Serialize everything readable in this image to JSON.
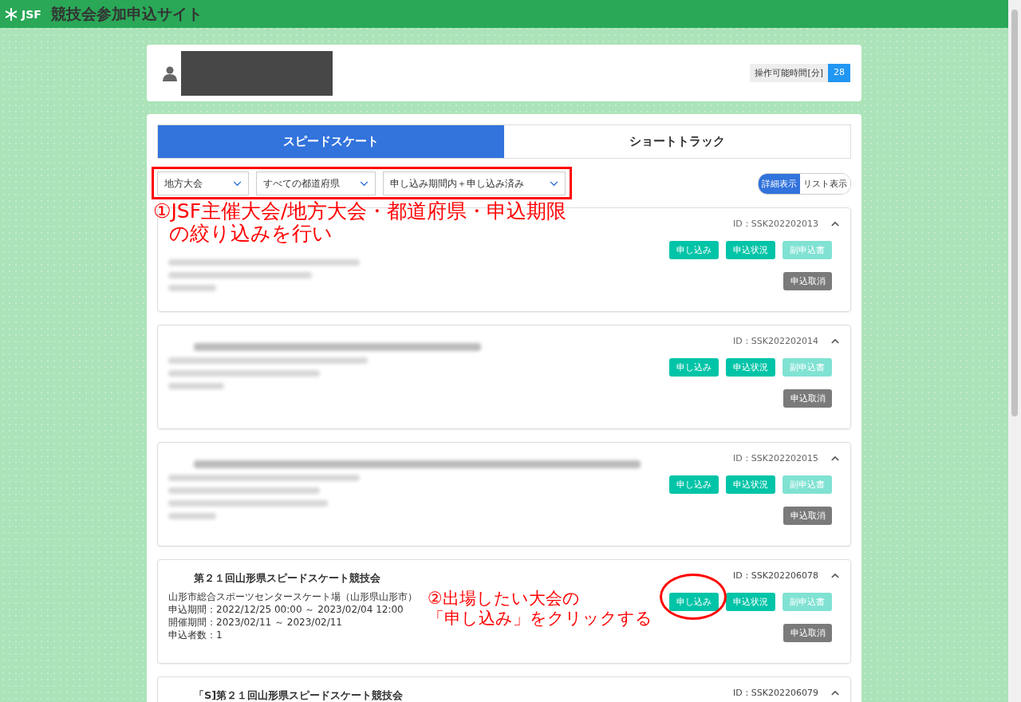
{
  "header": {
    "logo": "JSF",
    "title": "競技会参加申込サイト"
  },
  "user": {
    "time_label": "操作可能時間[分]",
    "time_value": "28"
  },
  "tabs": [
    {
      "label": "スピードスケート",
      "selected": true
    },
    {
      "label": "ショートトラック",
      "selected": false
    }
  ],
  "filters": [
    {
      "value": "地方大会"
    },
    {
      "value": "すべての都道府県"
    },
    {
      "value": "申し込み期間内＋申し込み済み"
    }
  ],
  "view_toggle": [
    {
      "label": "詳細表示",
      "selected": true
    },
    {
      "label": "リスト表示",
      "selected": false
    }
  ],
  "competitions": [
    {
      "kind": "blurred",
      "id": "ID：SSK202202013",
      "expanded": true,
      "buttons": [
        {
          "label": "申し込み",
          "disabled": false
        },
        {
          "label": "申込状況",
          "disabled": false
        },
        {
          "label": "副申込書",
          "disabled": true
        }
      ],
      "cancel": "申込取消"
    },
    {
      "kind": "blurred",
      "id": "ID：SSK202202014",
      "expanded": true,
      "buttons": [
        {
          "label": "申し込み",
          "disabled": false
        },
        {
          "label": "申込状況",
          "disabled": false
        },
        {
          "label": "副申込書",
          "disabled": true
        }
      ],
      "cancel": "申込取消"
    },
    {
      "kind": "blurred",
      "id": "ID：SSK202202015",
      "expanded": true,
      "buttons": [
        {
          "label": "申し込み",
          "disabled": false
        },
        {
          "label": "申込状況",
          "disabled": false
        },
        {
          "label": "副申込書",
          "disabled": true
        }
      ],
      "cancel": "申込取消"
    },
    {
      "kind": "clear",
      "title": "第２１回山形県スピードスケート競技会",
      "id": "ID：SSK202206078",
      "expanded": true,
      "details": [
        "山形市総合スポーツセンタースケート場（山形県山形市）",
        "申込期間：2022/12/25 00:00 ～ 2023/02/04 12:00",
        "開催期間：2023/02/11 ～ 2023/02/11",
        "申込者数：1"
      ],
      "buttons": [
        {
          "label": "申し込み",
          "disabled": false
        },
        {
          "label": "申込状況",
          "disabled": false
        },
        {
          "label": "副申込書",
          "disabled": true
        }
      ],
      "cancel": "申込取消"
    },
    {
      "kind": "clear",
      "title": "「S]第２１回山形県スピードスケート競技会",
      "id": "ID：SSK202206079",
      "expanded": true
    }
  ],
  "annotations": [
    {
      "lines": [
        "①JSF主催大会/地方大会・都道府県・申込期限",
        "の絞り込みを行い"
      ]
    },
    {
      "lines": [
        "②出場したい大会の",
        "「申し込み」をクリックする"
      ]
    }
  ]
}
